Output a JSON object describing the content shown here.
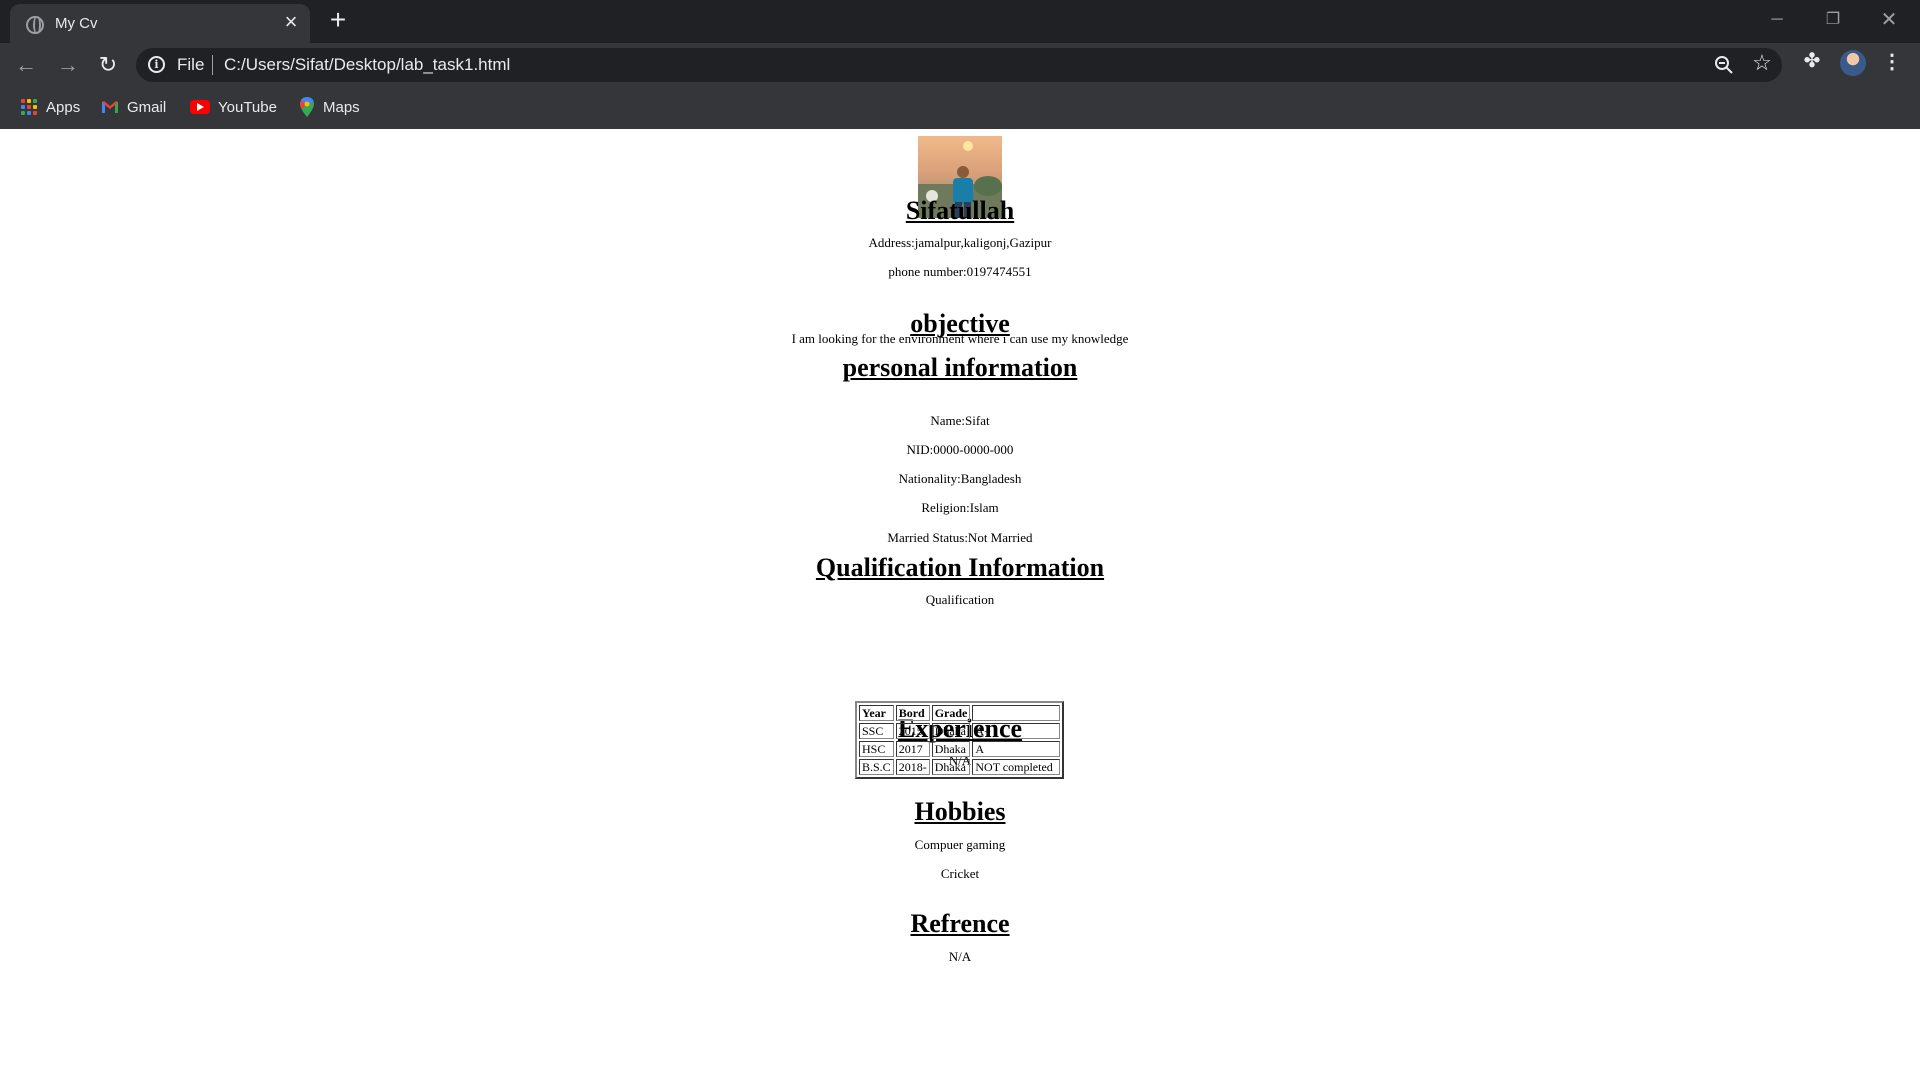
{
  "browser": {
    "tab_title": "My Cv",
    "omnibox_scheme": "File",
    "omnibox_url": "C:/Users/Sifat/Desktop/lab_task1.html",
    "bookmarks": [
      {
        "label": "Apps",
        "icon": "apps-grid-icon"
      },
      {
        "label": "Gmail",
        "icon": "gmail-icon"
      },
      {
        "label": "YouTube",
        "icon": "youtube-icon"
      },
      {
        "label": "Maps",
        "icon": "maps-icon"
      }
    ],
    "colors": {
      "frame": "#202124",
      "toolbar": "#35363a",
      "omnibox": "#202124",
      "text": "#e8eaed"
    }
  },
  "cv": {
    "name": "Sifatullah",
    "address": "Address:jamalpur,kaligonj,Gazipur",
    "phone": "phone number:0197474551",
    "objective_heading": "objective",
    "objective_text": "I am looking for the environment where i can use my knowledge",
    "personal_heading": "personal information",
    "personal": [
      "Name:Sifat",
      "NID:0000-0000-000",
      "Nationality:Bangladesh",
      "Religion:Islam",
      "Married Status:Not Married"
    ],
    "qualification_heading": "Qualification Information",
    "qualification_caption": "Qualification",
    "qualification_headers": [
      "Year",
      "Bord",
      "Grade",
      ""
    ],
    "qualification_rows": [
      [
        "SSC",
        "2015",
        "Dhaka",
        "A+"
      ],
      [
        "HSC",
        "2017",
        "Dhaka",
        "A"
      ],
      [
        "B.S.C",
        "2018-",
        "Dhaka",
        "NOT completed"
      ]
    ],
    "experience_heading": "Experience",
    "experience_text": "N/A",
    "hobbies_heading": "Hobbies",
    "hobbies": [
      "Compuer gaming",
      "Cricket"
    ],
    "reference_heading": "Refrence",
    "reference_text": "N/A"
  }
}
